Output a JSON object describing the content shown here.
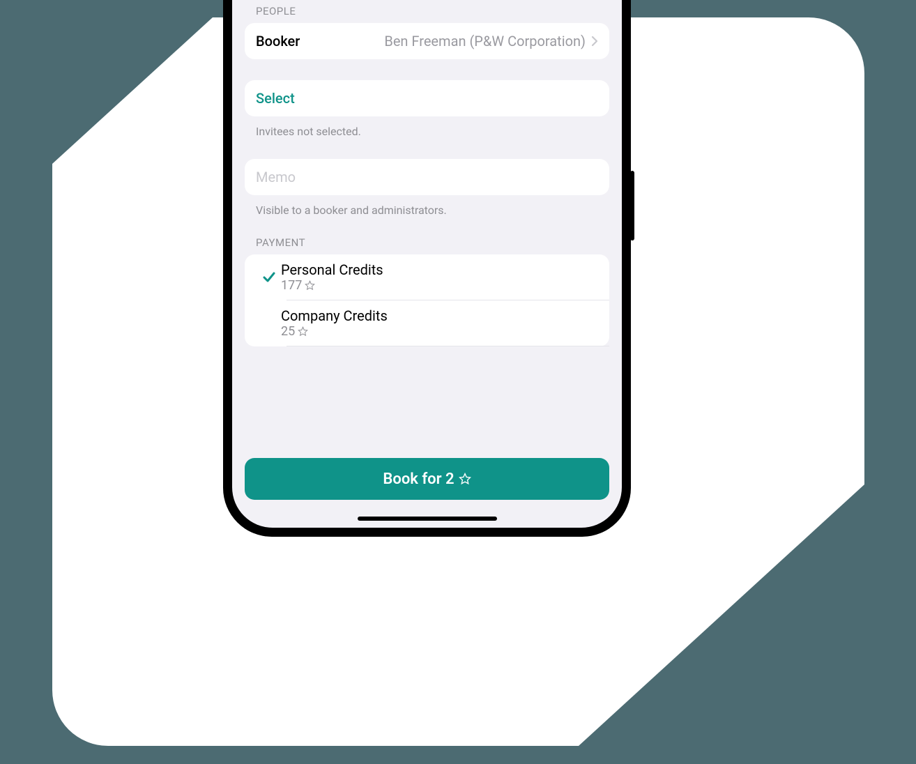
{
  "colors": {
    "accent": "#0f9389",
    "teal_dark": "#0a857c"
  },
  "people": {
    "section_label": "PEOPLE",
    "booker_label": "Booker",
    "booker_value": "Ben Freeman (P&W Corporation)"
  },
  "invitees": {
    "select_label": "Select",
    "hint": "Invitees not selected."
  },
  "memo": {
    "placeholder": "Memo",
    "hint": "Visible to a booker and administrators."
  },
  "payment": {
    "section_label": "PAYMENT",
    "options": [
      {
        "title": "Personal Credits",
        "amount": "177",
        "selected": true
      },
      {
        "title": "Company Credits",
        "amount": "25",
        "selected": false
      }
    ]
  },
  "book_button": {
    "label": "Book for 2"
  }
}
